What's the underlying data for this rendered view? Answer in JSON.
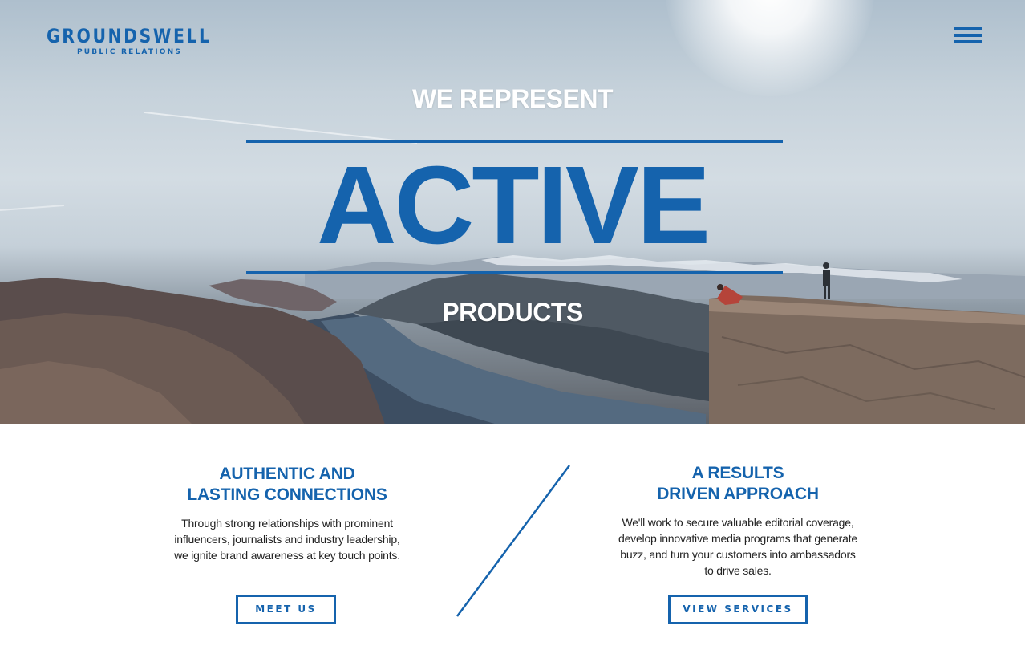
{
  "brand": {
    "name": "GROUNDSWELL",
    "tagline": "PUBLIC RELATIONS",
    "color": "#1563ad"
  },
  "header": {
    "menu_icon": "hamburger-menu-icon"
  },
  "hero": {
    "eyebrow": "WE REPRESENT",
    "headline": "ACTIVE",
    "subline": "PRODUCTS"
  },
  "features": [
    {
      "title_line1": "AUTHENTIC AND",
      "title_line2": "LASTING CONNECTIONS",
      "body": "Through strong relationships with prominent influencers, journalists and industry leadership, we ignite brand awareness at key touch points.",
      "button": "MEET US"
    },
    {
      "title_line1": "A RESULTS",
      "title_line2": "DRIVEN APPROACH",
      "body": "We'll work to secure valuable editorial coverage, develop innovative media programs that generate buzz, and turn your customers into ambassadors to drive sales.",
      "button": "VIEW SERVICES"
    }
  ]
}
